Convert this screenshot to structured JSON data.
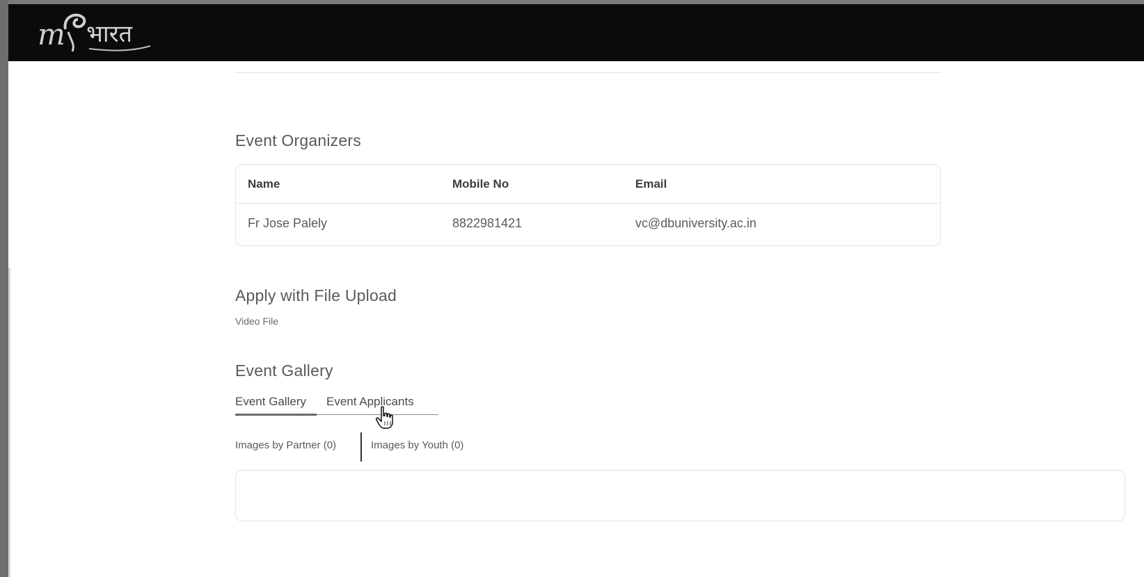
{
  "header": {
    "logo_name": "my-bharat-logo",
    "logo_text_prefix": "m",
    "logo_text_devanagari": "भारत"
  },
  "organizers": {
    "title": "Event Organizers",
    "columns": [
      "Name",
      "Mobile No",
      "Email"
    ],
    "rows": [
      {
        "name": "Fr Jose Palely",
        "mobile": "8822981421",
        "email": "vc@dbuniversity.ac.in"
      }
    ]
  },
  "upload": {
    "title": "Apply with File Upload",
    "file_type": "Video File"
  },
  "gallery": {
    "title": "Event Gallery",
    "tabs": [
      {
        "label": "Event Gallery",
        "active": true
      },
      {
        "label": "Event Applicants",
        "active": false
      }
    ],
    "filters": [
      {
        "label": "Images by Partner (0)"
      },
      {
        "label": "Images by Youth (0)"
      }
    ]
  },
  "colors": {
    "navbar_bg": "#0b0b0b",
    "text": "#4a4a4a",
    "border": "#e3e3e3"
  }
}
